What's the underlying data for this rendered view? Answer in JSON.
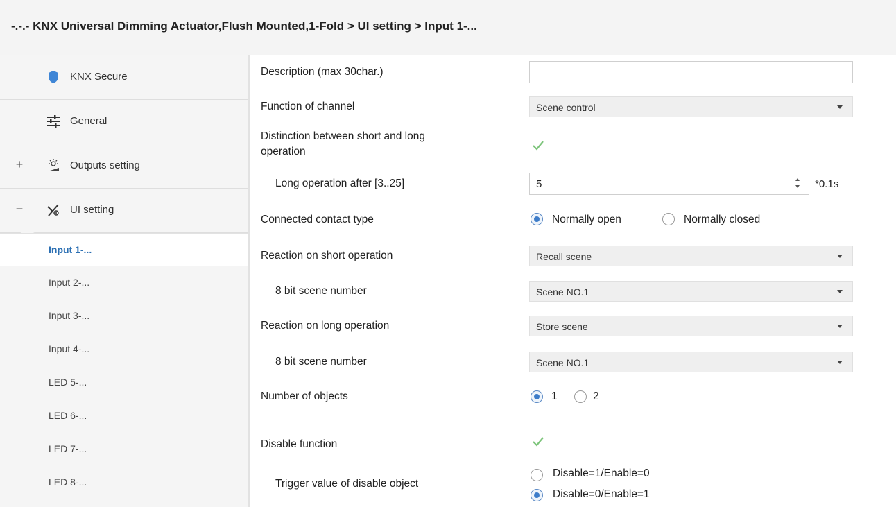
{
  "window": {
    "title": "-.-.- KNX Universal Dimming Actuator,Flush Mounted,1-Fold > UI setting > Input 1-..."
  },
  "sidebar": {
    "items": [
      {
        "label": "KNX Secure",
        "icon": "shield-icon"
      },
      {
        "label": "General",
        "icon": "sliders-icon"
      },
      {
        "label": "Outputs setting",
        "icon": "dimmer-icon",
        "expander": "+"
      },
      {
        "label": "UI setting",
        "icon": "ui-setting-icon",
        "expander": "−"
      }
    ],
    "subitems": [
      {
        "label": "Input 1-...",
        "selected": true
      },
      {
        "label": "Input 2-..."
      },
      {
        "label": "Input 3-..."
      },
      {
        "label": "Input 4-..."
      },
      {
        "label": "LED 5-..."
      },
      {
        "label": "LED 6-..."
      },
      {
        "label": "LED 7-..."
      },
      {
        "label": "LED 8-..."
      }
    ]
  },
  "form": {
    "description": {
      "label": "Description (max 30char.)",
      "value": ""
    },
    "function_of_channel": {
      "label": "Function of channel",
      "value": "Scene control"
    },
    "distinction": {
      "label_line1": "Distinction between short and long",
      "label_line2": "operation",
      "checked": true
    },
    "long_operation": {
      "label": "Long operation after [3..25]",
      "value": "5",
      "unit": "*0.1s"
    },
    "contact_type": {
      "label": "Connected contact type",
      "options": [
        "Normally open",
        "Normally closed"
      ],
      "selected": "Normally open"
    },
    "reaction_short": {
      "label": "Reaction on short operation",
      "value": "Recall scene"
    },
    "scene_number_short": {
      "label": "8 bit scene number",
      "value": "Scene NO.1"
    },
    "reaction_long": {
      "label": "Reaction on long operation",
      "value": "Store scene"
    },
    "scene_number_long": {
      "label": "8 bit scene number",
      "value": "Scene NO.1"
    },
    "number_of_objects": {
      "label": "Number of objects",
      "options": [
        "1",
        "2"
      ],
      "selected": "1"
    },
    "disable_function": {
      "label": "Disable function",
      "checked": true
    },
    "trigger_value": {
      "label": "Trigger value of disable object",
      "options": [
        "Disable=1/Enable=0",
        "Disable=0/Enable=1"
      ],
      "selected": "Disable=0/Enable=1"
    }
  },
  "colors": {
    "accent": "#2b6fb3",
    "radio_selected": "#3d7cc9",
    "check": "#7cc47a",
    "shield": "#3f86d6"
  }
}
